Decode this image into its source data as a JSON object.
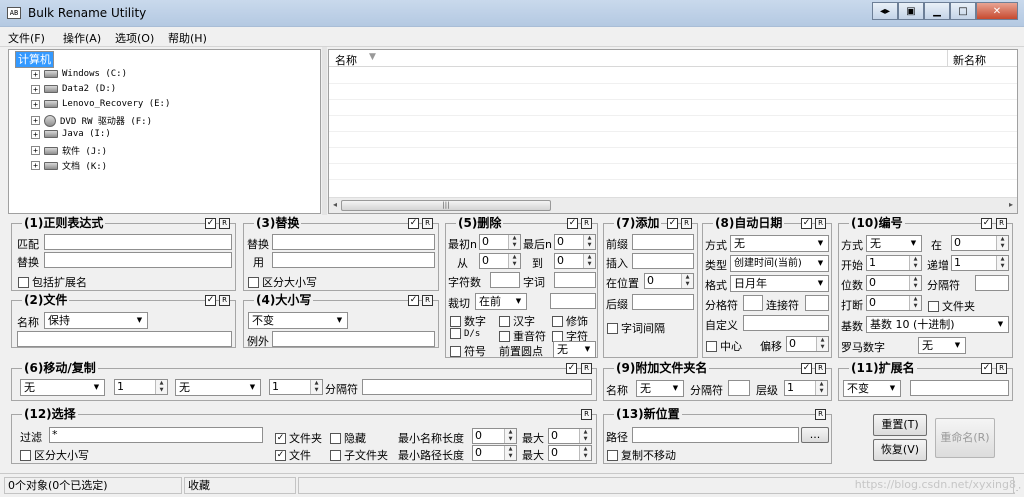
{
  "window": {
    "title": "Bulk Rename Utility",
    "icon": "AB"
  },
  "menu": [
    "文件(F)",
    "操作(A)",
    "选项(O)",
    "帮助(H)"
  ],
  "tree": {
    "root": "计算机",
    "items": [
      {
        "label": "Windows (C:)",
        "icon": "drive-icon"
      },
      {
        "label": "Data2 (D:)",
        "icon": "drive-icon"
      },
      {
        "label": "Lenovo_Recovery (E:)",
        "icon": "drive-icon"
      },
      {
        "label": "DVD RW 驱动器 (F:)",
        "icon": "dvd-icon"
      },
      {
        "label": "Java (I:)",
        "icon": "drive-icon"
      },
      {
        "label": "软件 (J:)",
        "icon": "drive-icon"
      },
      {
        "label": "文档 (K:)",
        "icon": "drive-icon"
      }
    ]
  },
  "filelist": {
    "col_name": "名称",
    "col_newname": "新名称"
  },
  "p1": {
    "title": "(1)正则表达式",
    "match": "匹配",
    "replace": "替换",
    "include_ext": "包括扩展名",
    "r": "R"
  },
  "p2": {
    "title": "(2)文件",
    "name": "名称",
    "name_val": "保持",
    "r": "R"
  },
  "p3": {
    "title": "(3)替换",
    "replace": "替换",
    "with": "用",
    "case": "区分大小写",
    "r": "R"
  },
  "p4": {
    "title": "(4)大小写",
    "case_val": "不变",
    "except": "例外",
    "r": "R"
  },
  "p5": {
    "title": "(5)删除",
    "first_n": "最初n",
    "last_n": "最后n",
    "from": "从",
    "to": "到",
    "chars": "字符数",
    "words": "字词",
    "crop": "裁切",
    "crop_val": "在前",
    "digits": "数字",
    "high": "汉字",
    "trim": "修饰",
    "ds": "D/s",
    "accents": "重音符",
    "chars2": "字符",
    "sym": "符号",
    "lead": "前置圆点",
    "lead_val": "无",
    "v0": "0",
    "r": "R"
  },
  "p6": {
    "title": "(6)移动/复制",
    "sel1": "无",
    "n1": "1",
    "sel2": "无",
    "n2": "1",
    "sep": "分隔符",
    "r": "R"
  },
  "p7": {
    "title": "(7)添加",
    "prefix": "前缀",
    "insert": "插入",
    "at_pos": "在位置",
    "pos_val": "0",
    "suffix": "后缀",
    "word_space": "字词间隔",
    "r": "R"
  },
  "p8": {
    "title": "(8)自动日期",
    "mode": "方式",
    "mode_val": "无",
    "type": "类型",
    "type_val": "创建时间(当前)",
    "fmt": "格式",
    "fmt_val": "日月年",
    "sep": "分格符",
    "con": "连接符",
    "custom": "自定义",
    "center": "中心",
    "offset": "偏移",
    "off_val": "0",
    "r": "R"
  },
  "p9": {
    "title": "(9)附加文件夹名",
    "name": "名称",
    "name_val": "无",
    "sep": "分隔符",
    "level": "层级",
    "level_val": "1",
    "r": "R"
  },
  "p10": {
    "title": "(10)编号",
    "mode": "方式",
    "mode_val": "无",
    "at": "在",
    "at_val": "0",
    "start": "开始",
    "start_val": "1",
    "inc": "递增",
    "inc_val": "1",
    "pad": "位数",
    "pad_val": "0",
    "sep": "分隔符",
    "brk": "打断",
    "brk_val": "0",
    "folder": "文件夹",
    "base": "基数",
    "base_val": "基数 10 (十进制)",
    "roman": "罗马数字",
    "roman_val": "无",
    "r": "R"
  },
  "p11": {
    "title": "(11)扩展名",
    "ext_val": "不变",
    "r": "R"
  },
  "p12": {
    "title": "(12)选择",
    "filter": "过滤",
    "filter_val": "*",
    "case": "区分大小写",
    "folders": "文件夹",
    "hidden": "隐藏",
    "files": "文件",
    "subfolders": "子文件夹",
    "min_name": "最小名称长度",
    "max": "最大",
    "min_path": "最小路径长度",
    "v0": "0",
    "r": "R"
  },
  "p13": {
    "title": "(13)新位置",
    "path": "路径",
    "browse": "...",
    "copy": "复制不移动",
    "r": "R"
  },
  "buttons": {
    "reset": "重置(T)",
    "revert": "恢复(V)",
    "rename": "重命名(R)"
  },
  "status": {
    "objects": "0个对象(0个已选定)",
    "favorites": "收藏",
    "watermark": "https://blog.csdn.net/xyxing8"
  }
}
